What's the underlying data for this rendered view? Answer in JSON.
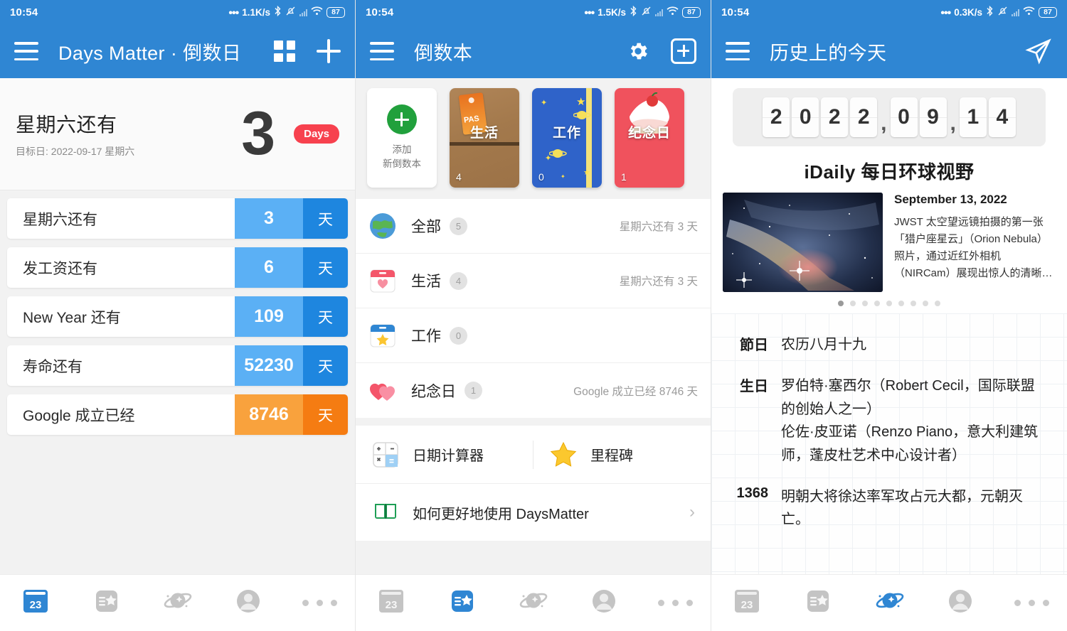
{
  "screens": [
    {
      "statusbar": {
        "time": "10:54",
        "net_speed": "1.1K/s",
        "battery": "87"
      },
      "appbar": {
        "title": "Days Matter · 倒数日"
      },
      "hero": {
        "title": "星期六还有",
        "subtitle": "目标日: 2022-09-17 星期六",
        "number": "3",
        "badge": "Days"
      },
      "cards": [
        {
          "label": "星期六还有",
          "value": "3",
          "unit": "天",
          "color": "blue"
        },
        {
          "label": "发工资还有",
          "value": "6",
          "unit": "天",
          "color": "blue"
        },
        {
          "label": "New Year 还有",
          "value": "109",
          "unit": "天",
          "color": "blue"
        },
        {
          "label": "寿命还有",
          "value": "52230",
          "unit": "天",
          "color": "blue"
        },
        {
          "label": "Google 成立已经",
          "value": "8746",
          "unit": "天",
          "color": "orange"
        }
      ],
      "nav_active": 0
    },
    {
      "statusbar": {
        "time": "10:54",
        "net_speed": "1.5K/s",
        "battery": "87"
      },
      "appbar": {
        "title": "倒数本"
      },
      "books": [
        {
          "kind": "add",
          "line1": "添加",
          "line2": "新倒数本"
        },
        {
          "kind": "life",
          "title": "生活",
          "count": "4"
        },
        {
          "kind": "work",
          "title": "工作",
          "count": "0"
        },
        {
          "kind": "anniv",
          "title": "纪念日",
          "count": "1"
        }
      ],
      "list": [
        {
          "icon": "globe-icon",
          "name": "全部",
          "count": "5",
          "right": "星期六还有 3 天"
        },
        {
          "icon": "calendar-heart-icon",
          "name": "生活",
          "count": "4",
          "right": "星期六还有 3 天"
        },
        {
          "icon": "calendar-star-icon",
          "name": "工作",
          "count": "0",
          "right": ""
        },
        {
          "icon": "hearts-icon",
          "name": "纪念日",
          "count": "1",
          "right": "Google 成立已经 8746 天"
        }
      ],
      "tools": [
        {
          "icon": "calculator-icon",
          "label": "日期计算器"
        },
        {
          "icon": "star-icon",
          "label": "里程碑"
        }
      ],
      "help": {
        "icon": "book-icon",
        "label": "如何更好地使用 DaysMatter"
      },
      "nav_active": 1
    },
    {
      "statusbar": {
        "time": "10:54",
        "net_speed": "0.3K/s",
        "battery": "87"
      },
      "appbar": {
        "title": "历史上的今天"
      },
      "flip_digits": [
        "2",
        "0",
        "2",
        "2",
        ",",
        "0",
        "9",
        ",",
        "1",
        "4"
      ],
      "idaily": {
        "title": "iDaily 每日环球视野",
        "date": "September 13, 2022",
        "desc": "JWST 太空望远镜拍摄的第一张「猎户座星云」（Orion Nebula）照片，通过近红外相机（NIRCam）展现出惊人的清晰…",
        "dots_total": 9,
        "dot_active": 0
      },
      "history": [
        {
          "key": "節日",
          "value": "农历八月十九"
        },
        {
          "key": "生日",
          "value": "罗伯特·塞西尔（Robert Cecil，国际联盟的创始人之一）\n伦佐·皮亚诺（Renzo Piano，意大利建筑师，蓬皮杜艺术中心设计者）"
        },
        {
          "key": "1368",
          "value": "明朝大将徐达率军攻占元大都，元朝灭亡。"
        }
      ],
      "nav_active": 2
    }
  ],
  "bottom_nav": [
    {
      "name": "calendar-23-icon"
    },
    {
      "name": "notebook-star-icon"
    },
    {
      "name": "planet-icon"
    },
    {
      "name": "profile-icon"
    },
    {
      "name": "more-icon"
    }
  ],
  "colors": {
    "brand_blue": "#2f86d3",
    "card_blue_light": "#5bb0f5",
    "card_blue_dark": "#1e86df",
    "card_orange_light": "#f9a23d",
    "card_orange_dark": "#f57c12",
    "badge_red": "#f7414e",
    "nav_active": "#2f86d3",
    "nav_inactive": "#c4c4c4"
  }
}
